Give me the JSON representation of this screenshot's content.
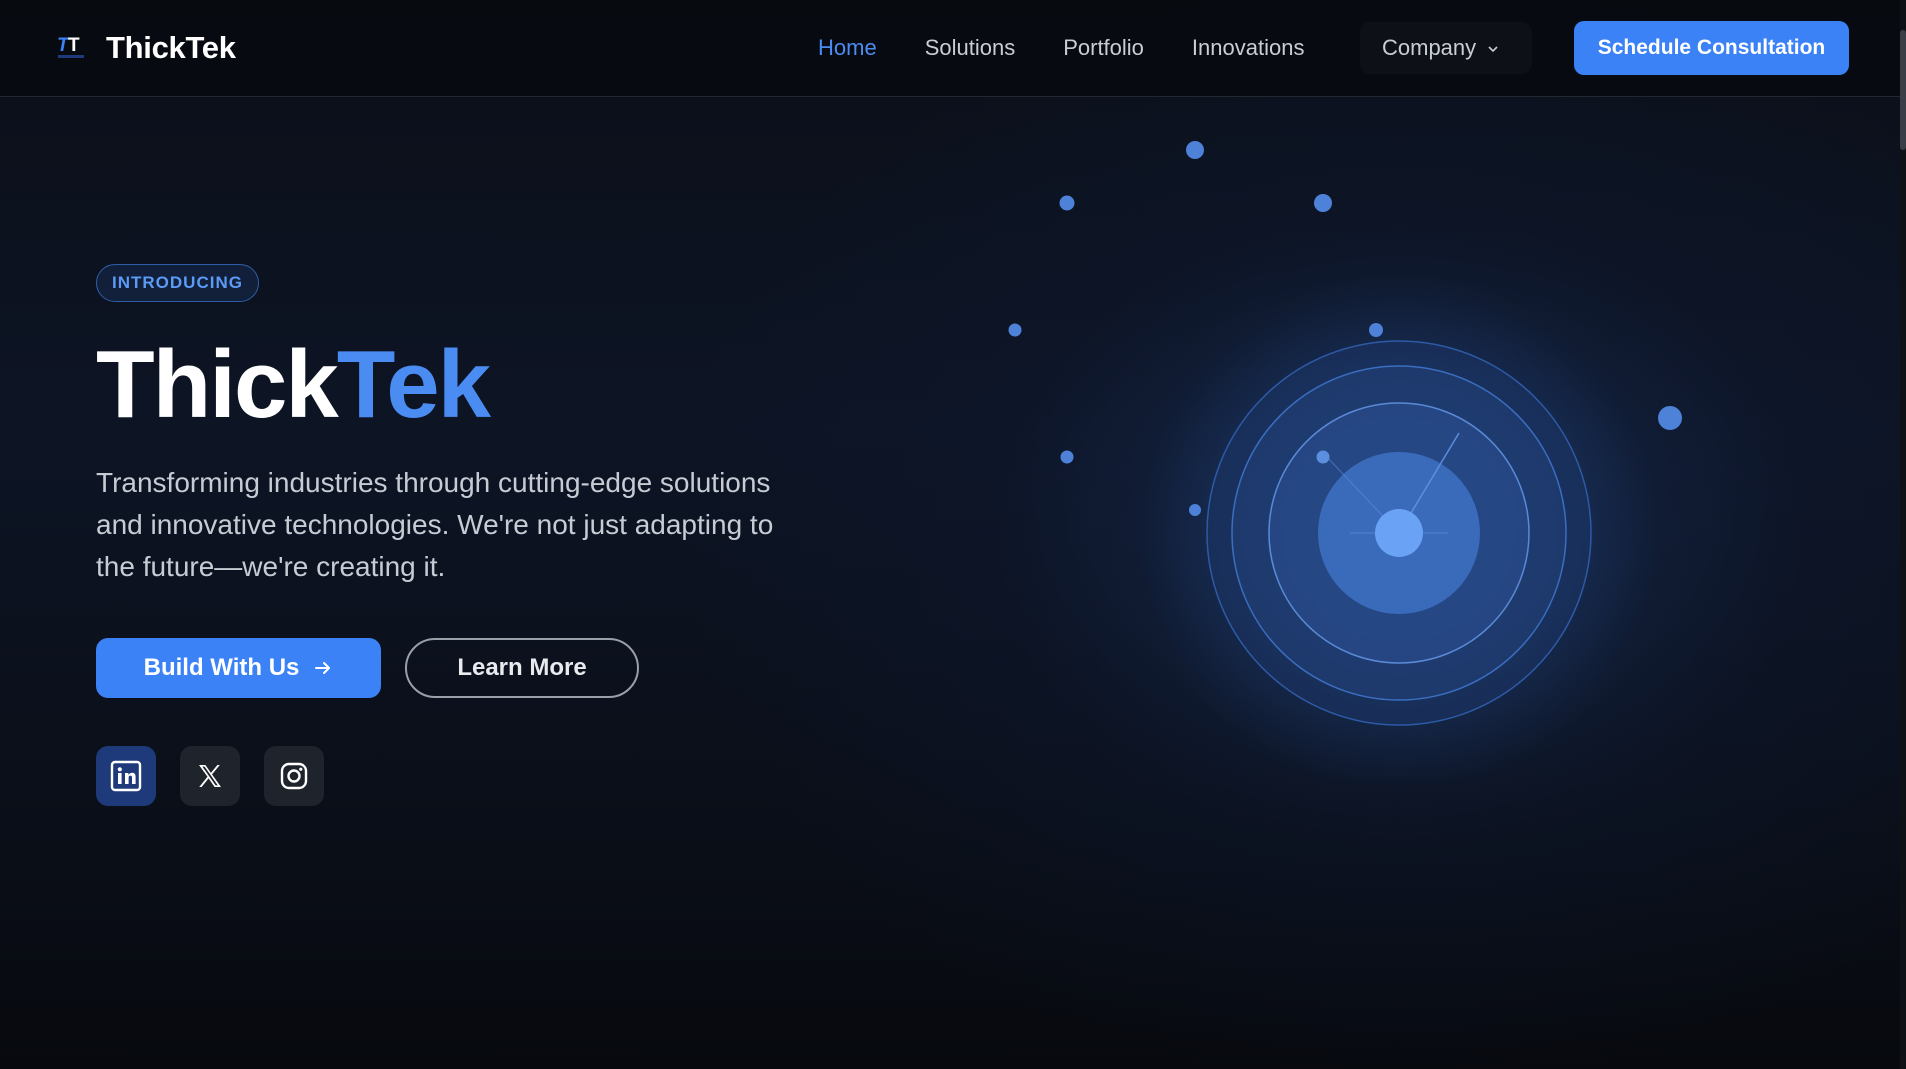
{
  "header": {
    "brand_name": "ThickTek",
    "logo_text": "TT",
    "nav": [
      {
        "label": "Home",
        "active": true
      },
      {
        "label": "Solutions",
        "active": false
      },
      {
        "label": "Portfolio",
        "active": false
      },
      {
        "label": "Innovations",
        "active": false
      }
    ],
    "company_label": "Company",
    "cta_label": "Schedule Consultation"
  },
  "hero": {
    "badge": "INTRODUCING",
    "title_part1": "Thick",
    "title_part2": "Tek",
    "description": "Transforming industries through cutting-edge solutions and innovative technologies. We're not just adapting to the future—we're creating it.",
    "primary_button": "Build With Us",
    "secondary_button": "Learn More"
  },
  "social": [
    {
      "name": "linkedin-icon"
    },
    {
      "name": "x-icon"
    },
    {
      "name": "instagram-icon"
    }
  ],
  "colors": {
    "accent": "#3b82f6",
    "accent_text": "#4a8cf2",
    "background": "#0b0f18",
    "linkedin_bg": "#1e3a7a"
  }
}
